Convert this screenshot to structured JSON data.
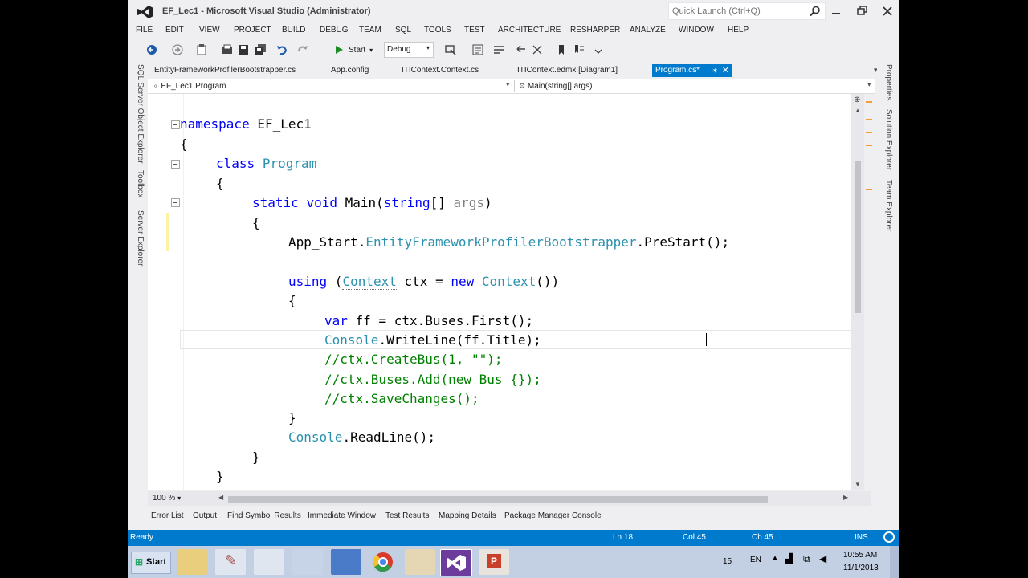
{
  "window": {
    "title": "EF_Lec1 - Microsoft Visual Studio (Administrator)",
    "quick_launch_placeholder": "Quick Launch (Ctrl+Q)"
  },
  "menu": [
    "FILE",
    "EDIT",
    "VIEW",
    "PROJECT",
    "BUILD",
    "DEBUG",
    "TEAM",
    "SQL",
    "TOOLS",
    "TEST",
    "ARCHITECTURE",
    "RESHARPER",
    "ANALYZE",
    "WINDOW",
    "HELP"
  ],
  "toolbar": {
    "start_label": "Start",
    "config": "Debug"
  },
  "tabs": [
    {
      "label": "EntityFrameworkProfilerBootstrapper.cs"
    },
    {
      "label": "App.config"
    },
    {
      "label": "ITIContext.Context.cs"
    },
    {
      "label": "ITIContext.edmx [Diagram1]"
    },
    {
      "label": "Program.cs*",
      "active": true
    }
  ],
  "navbar": {
    "left": "EF_Lec1.Program",
    "right": "Main(string[] args)"
  },
  "left_panels": [
    "SQL Server Object Explorer",
    "Toolbox",
    "Server Explorer"
  ],
  "right_panels": [
    "Properties",
    "Solution Explorer",
    "Team Explorer"
  ],
  "code": {
    "l1_kw": "namespace",
    "l1_name": "EF_Lec1",
    "l2": "{",
    "l3_kw": "class",
    "l3_name": "Program",
    "l4": "{",
    "l5_kw1": "static",
    "l5_kw2": "void",
    "l5_name": "Main(",
    "l5_kw3": "string",
    "l5_brackets": "[] ",
    "l5_param": "args",
    "l5_close": ")",
    "l6": "{",
    "l7_a": "App_Start.",
    "l7_type": "EntityFrameworkProfilerBootstrapper",
    "l7_b": ".PreStart();",
    "l8_kw": "using",
    "l8_a": " (",
    "l8_type1": "Context",
    "l8_b": " ctx = ",
    "l8_kw2": "new",
    "l8_sp": " ",
    "l8_type2": "Context",
    "l8_c": "())",
    "l9": "{",
    "l10_kw": "var",
    "l10_rest": " ff = ctx.Buses.First();",
    "l11_type": "Console",
    "l11_rest": ".WriteLine(ff.Title);",
    "l12": "//ctx.CreateBus(1, \"\");",
    "l13": "//ctx.Buses.Add(new Bus {});",
    "l14": "//ctx.SaveChanges();",
    "l15": "}",
    "l16_type": "Console",
    "l16_rest": ".ReadLine();",
    "l17": "}",
    "l18": "}"
  },
  "zoom": "100 %",
  "tool_tabs": [
    "Error List",
    "Output",
    "Find Symbol Results",
    "Immediate Window",
    "Test Results",
    "Mapping Details",
    "Package Manager Console"
  ],
  "status": {
    "state": "Ready",
    "line": "Ln 18",
    "col": "Col 45",
    "ch": "Ch 45",
    "mode": "INS"
  },
  "taskbar": {
    "start": "Start",
    "lang": "EN",
    "num": "15",
    "time": "10:55 AM",
    "date": "11/1/2013"
  },
  "colors": {
    "accent": "#007ACC",
    "keyword": "#0000FF",
    "type": "#2B91AF",
    "comment": "#008000"
  }
}
